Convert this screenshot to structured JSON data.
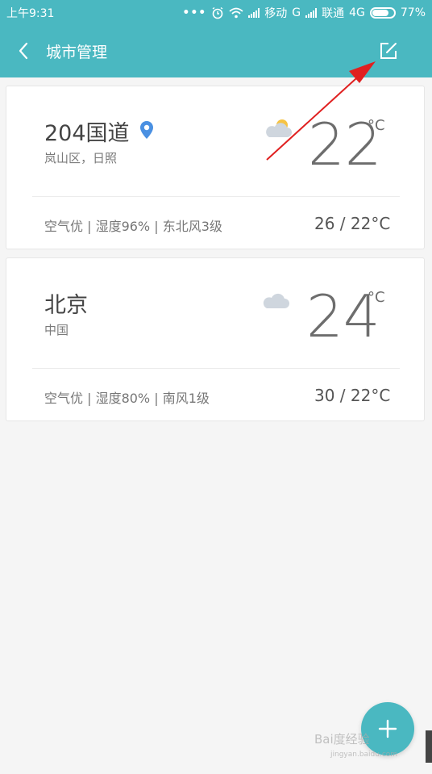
{
  "status_bar": {
    "time": "上午9:31",
    "dots": "•••",
    "carrier1": "移动",
    "net1": "G",
    "carrier2": "联通",
    "net2": "4G",
    "battery": "77%",
    "battery_level": 0.77
  },
  "header": {
    "title": "城市管理",
    "back_icon": "chevron-left-icon",
    "edit_icon": "edit-square-icon"
  },
  "cities": [
    {
      "name": "204国道",
      "region": "岚山区，日照",
      "temp": "22",
      "unit": "°C",
      "info": "空气优 | 湿度96% | 东北风3级",
      "range": "26 / 22°C",
      "weather_icon": "partly-cloudy-icon",
      "location_icon": "location-pin-icon"
    },
    {
      "name": "北京",
      "region": "中国",
      "temp": "24",
      "unit": "°C",
      "info": "空气优 | 湿度80% | 南风1级",
      "range": "30 / 22°C",
      "weather_icon": "cloudy-icon"
    }
  ],
  "fab": {
    "icon": "plus-icon"
  },
  "watermark": {
    "text": "Bai度经验",
    "sub": "jingyan.baidu.com"
  },
  "colors": {
    "accent": "#4ab8c1",
    "pin": "#4a90e2",
    "sun": "#f6c343",
    "cloud": "#cfd6de",
    "annotation": "#e02020"
  }
}
